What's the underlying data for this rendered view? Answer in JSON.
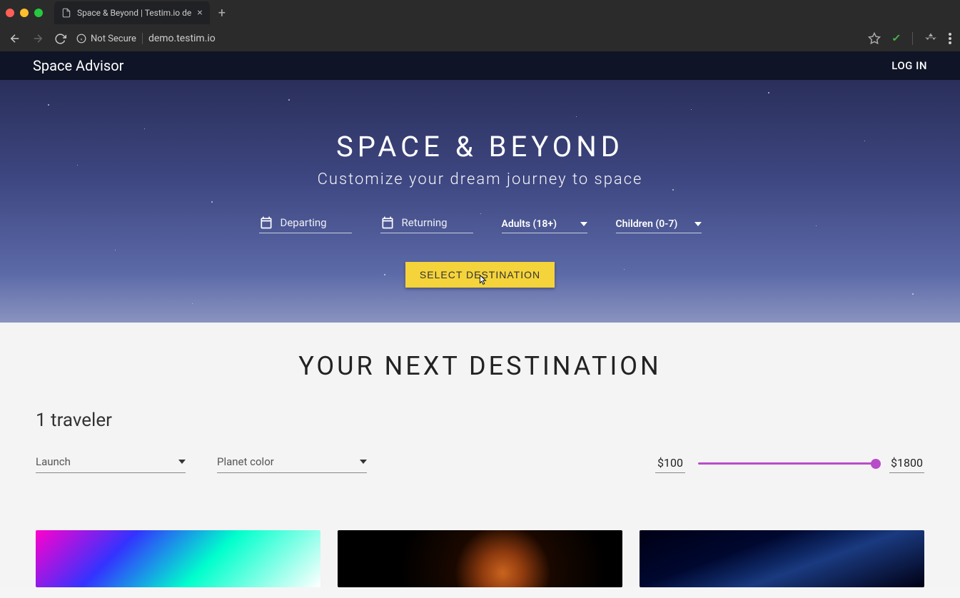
{
  "browser": {
    "tab_title": "Space & Beyond | Testim.io de",
    "security_label": "Not Secure",
    "url": "demo.testim.io"
  },
  "nav": {
    "brand": "Space Advisor",
    "login": "LOG IN"
  },
  "hero": {
    "title": "SPACE & BEYOND",
    "subtitle": "Customize your dream journey to space",
    "departing_label": "Departing",
    "returning_label": "Returning",
    "adults_label": "Adults (18+)",
    "children_label": "Children (0-7)",
    "cta": "SELECT DESTINATION"
  },
  "content": {
    "section_title": "YOUR NEXT DESTINATION",
    "traveler_text": "1 traveler",
    "launch_label": "Launch",
    "planet_color_label": "Planet color",
    "price_min": "$100",
    "price_max": "$1800"
  }
}
